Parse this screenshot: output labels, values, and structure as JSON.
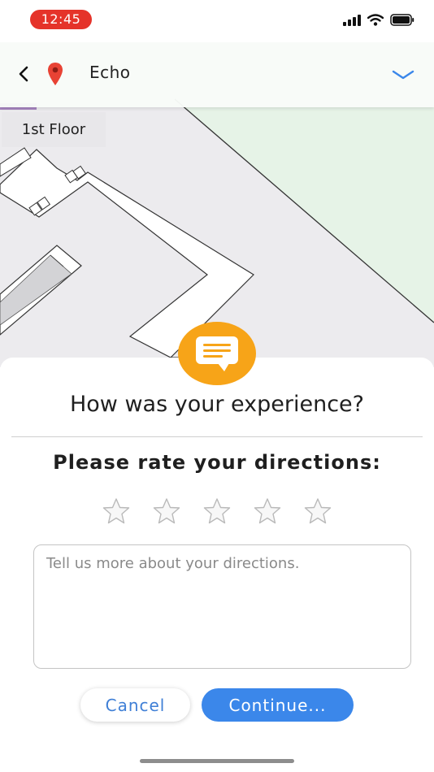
{
  "status_bar": {
    "time": "12:45",
    "icons": [
      "signal-icon",
      "wifi-icon",
      "battery-icon"
    ]
  },
  "header": {
    "title": "Echo",
    "back_icon": "back-chevron-icon",
    "location_icon": "map-pin-icon",
    "expand_icon": "chevron-down-icon"
  },
  "map": {
    "floor_label": "1st Floor"
  },
  "feedback": {
    "badge_icon": "chat-bubble-icon",
    "question": "How was your experience?",
    "rate_title": "Please rate your directions:",
    "rating": {
      "max": 5,
      "value": 0
    },
    "comment_value": "",
    "comment_placeholder": "Tell us more about your directions.",
    "cancel_label": "Cancel",
    "continue_label": "Continue..."
  },
  "colors": {
    "time_pill": "#e5332a",
    "accent_blue": "#3b87ea",
    "badge_orange": "#f7a418",
    "pin_red": "#e84234"
  }
}
